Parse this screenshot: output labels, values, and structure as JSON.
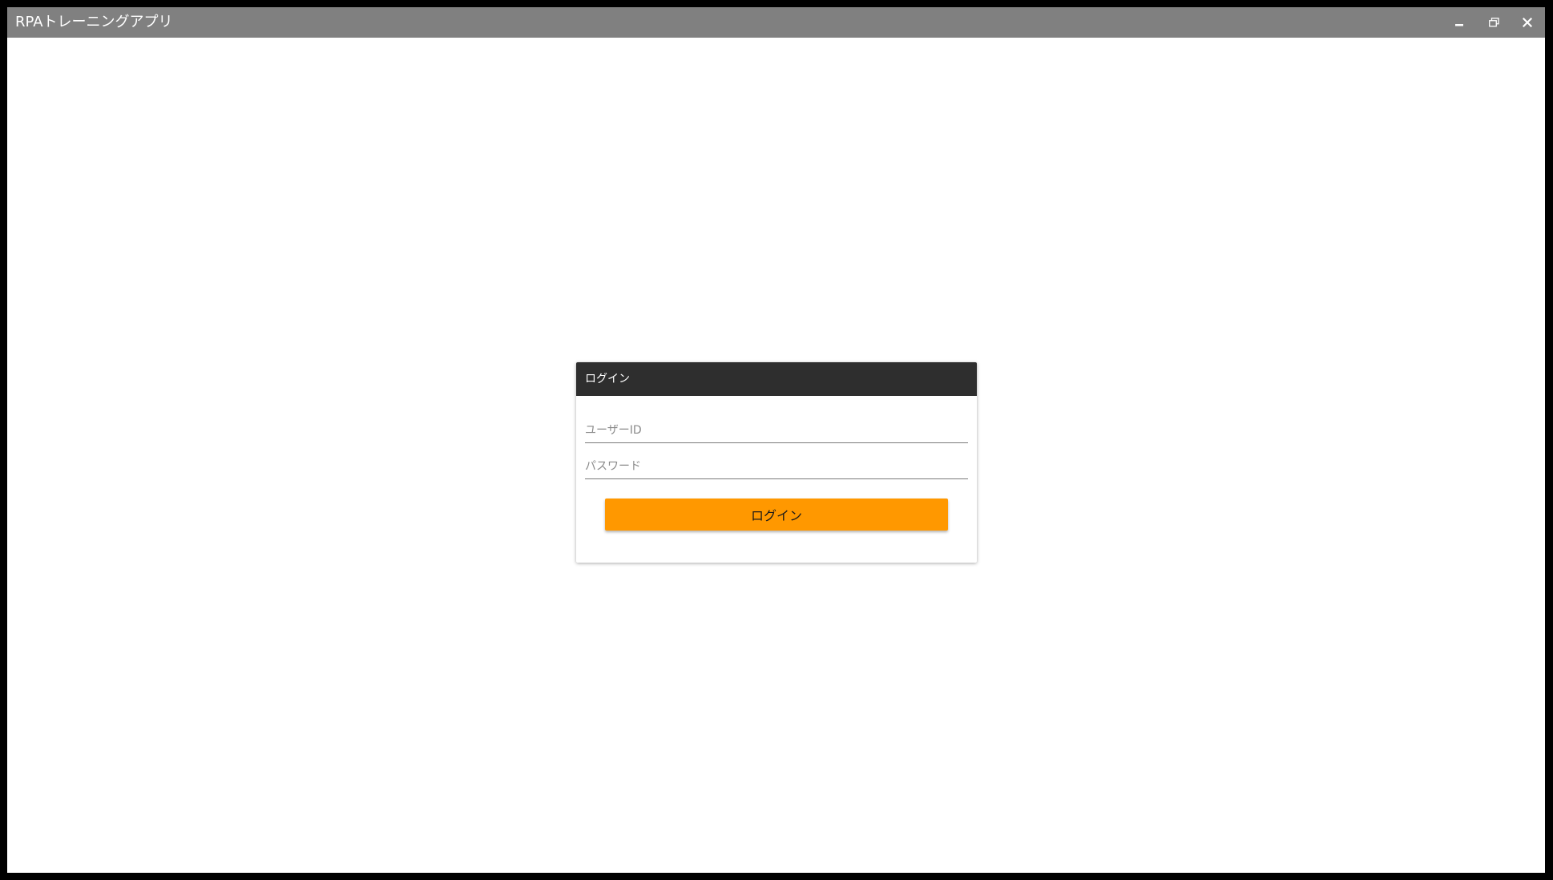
{
  "window": {
    "title": "RPAトレーニングアプリ",
    "controls": {
      "minimize_icon": "minimize-icon",
      "restore_icon": "restore-icon",
      "close_icon": "close-icon"
    }
  },
  "login_card": {
    "header_title": "ログイン",
    "user_id": {
      "placeholder": "ユーザーID",
      "value": ""
    },
    "password": {
      "placeholder": "パスワード",
      "value": ""
    },
    "submit_label": "ログイン"
  },
  "colors": {
    "titlebar": "#808080",
    "card_header": "#2e2e2e",
    "accent_button": "#ff9800",
    "background": "#ffffff",
    "frame": "#000000"
  }
}
